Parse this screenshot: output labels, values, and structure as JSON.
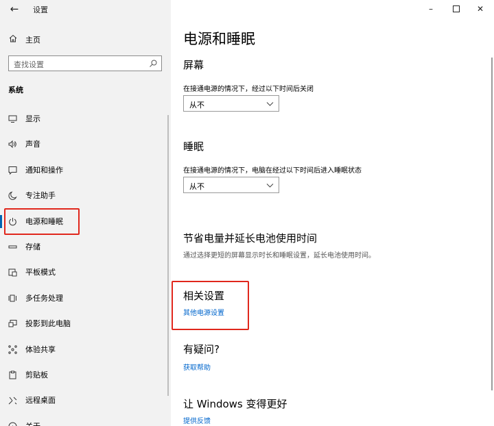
{
  "app": {
    "title": "设置"
  },
  "sidebar": {
    "home_label": "主页",
    "search_placeholder": "查找设置",
    "section_label": "系统",
    "items": [
      {
        "label": "显示",
        "icon": "monitor-icon"
      },
      {
        "label": "声音",
        "icon": "speaker-icon"
      },
      {
        "label": "通知和操作",
        "icon": "notification-icon"
      },
      {
        "label": "专注助手",
        "icon": "moon-icon"
      },
      {
        "label": "电源和睡眠",
        "icon": "power-icon",
        "active": true
      },
      {
        "label": "存储",
        "icon": "storage-icon"
      },
      {
        "label": "平板模式",
        "icon": "tablet-icon"
      },
      {
        "label": "多任务处理",
        "icon": "multitask-icon"
      },
      {
        "label": "投影到此电脑",
        "icon": "project-icon"
      },
      {
        "label": "体验共享",
        "icon": "share-icon"
      },
      {
        "label": "剪贴板",
        "icon": "clipboard-icon"
      },
      {
        "label": "远程桌面",
        "icon": "remote-icon"
      },
      {
        "label": "关于",
        "icon": "info-icon"
      }
    ]
  },
  "main": {
    "title": "电源和睡眠",
    "screen": {
      "heading": "屏幕",
      "desc": "在接通电源的情况下，经过以下时间后关闭",
      "value": "从不"
    },
    "sleep": {
      "heading": "睡眠",
      "desc": "在接通电源的情况下，电脑在经过以下时间后进入睡眠状态",
      "value": "从不"
    },
    "battery": {
      "heading": "节省电量并延长电池使用时间",
      "desc": "通过选择更短的屏幕显示时长和睡眠设置，延长电池使用时间。"
    },
    "related": {
      "heading": "相关设置",
      "link": "其他电源设置"
    },
    "question": {
      "heading": "有疑问?",
      "link": "获取帮助"
    },
    "improve": {
      "heading": "让 Windows 变得更好",
      "link": "提供反馈"
    }
  },
  "colors": {
    "accent": "#0063b1",
    "link": "#0066cc",
    "highlight": "#e0261b",
    "sidebar_bg": "#f2f2f2"
  }
}
